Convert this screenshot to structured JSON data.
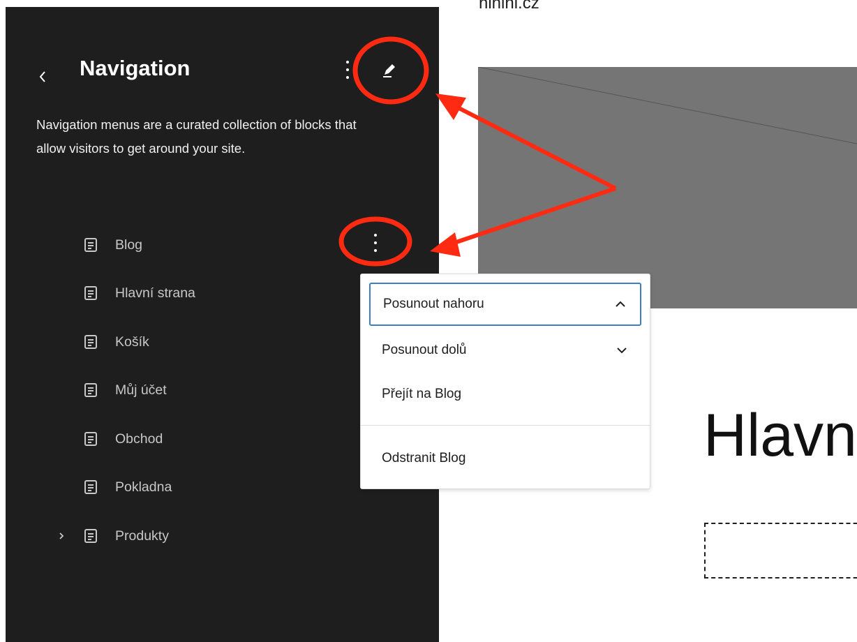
{
  "sidebar": {
    "title": "Navigation",
    "description": "Navigation menus are a curated collection of blocks that allow visitors to get around your site.",
    "back_icon": "chevron-left-icon",
    "more_icon": "more-vertical-icon",
    "edit_icon": "pencil-icon",
    "items": [
      {
        "label": "Blog",
        "icon": "page-icon"
      },
      {
        "label": "Hlavní strana",
        "icon": "page-icon"
      },
      {
        "label": "Košík",
        "icon": "page-icon"
      },
      {
        "label": "Můj účet",
        "icon": "page-icon"
      },
      {
        "label": "Obchod",
        "icon": "page-icon"
      },
      {
        "label": "Pokladna",
        "icon": "page-icon"
      },
      {
        "label": "Produkty",
        "icon": "page-icon",
        "expandable": true
      }
    ]
  },
  "menu": {
    "items": [
      {
        "label": "Posunout nahoru",
        "icon": "chevron-up-icon"
      },
      {
        "label": "Posunout dolů",
        "icon": "chevron-down-icon"
      },
      {
        "label": "Přejít na Blog"
      },
      {
        "label": "Odstranit Blog"
      }
    ]
  },
  "canvas": {
    "site_title": "ninini.cz",
    "heading": "Hlavn"
  },
  "colors": {
    "sidebar_bg": "#1e1e1e",
    "annotation": "#ff2a12",
    "focus_border": "#3d7fbf",
    "placeholder": "#757575"
  }
}
